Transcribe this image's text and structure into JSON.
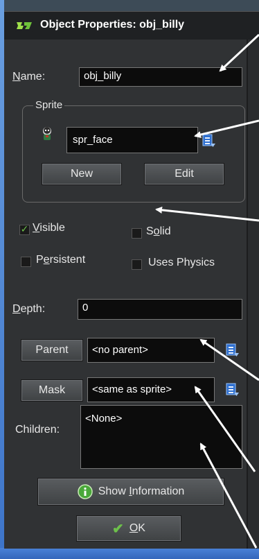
{
  "window": {
    "title": "Object Properties: obj_billy"
  },
  "name": {
    "label_underlined": "N",
    "label_rest": "ame:",
    "value": "obj_billy"
  },
  "sprite": {
    "group_title": "Sprite",
    "value": "spr_face",
    "new_label": "New",
    "edit_label": "Edit"
  },
  "checkboxes": {
    "visible": {
      "underlined": "V",
      "rest": "isible",
      "checked": true
    },
    "solid": {
      "pre": "S",
      "underlined": "o",
      "rest": "lid",
      "checked": false
    },
    "persistent": {
      "pre": "P",
      "underlined": "e",
      "rest": "rsistent",
      "checked": false
    },
    "physics": {
      "label": "Uses Physics",
      "checked": false
    }
  },
  "depth": {
    "label_underlined": "D",
    "label_rest": "epth:",
    "value": "0"
  },
  "parent": {
    "button_label": "Parent",
    "value": "<no parent>"
  },
  "mask": {
    "button_label": "Mask",
    "value": "<same as sprite>"
  },
  "children": {
    "label": "Children:",
    "value": "<None>"
  },
  "buttons": {
    "show_info_pre": "Show ",
    "show_info_underlined": "I",
    "show_info_rest": "nformation",
    "ok_underlined": "O",
    "ok_rest": "K"
  },
  "colors": {
    "background": "#303234",
    "titlebar": "#1f2123",
    "field": "#0c0c0c",
    "check": "#6dc04b",
    "arrow": "#ffffff",
    "desktop": "#3d74c9"
  }
}
